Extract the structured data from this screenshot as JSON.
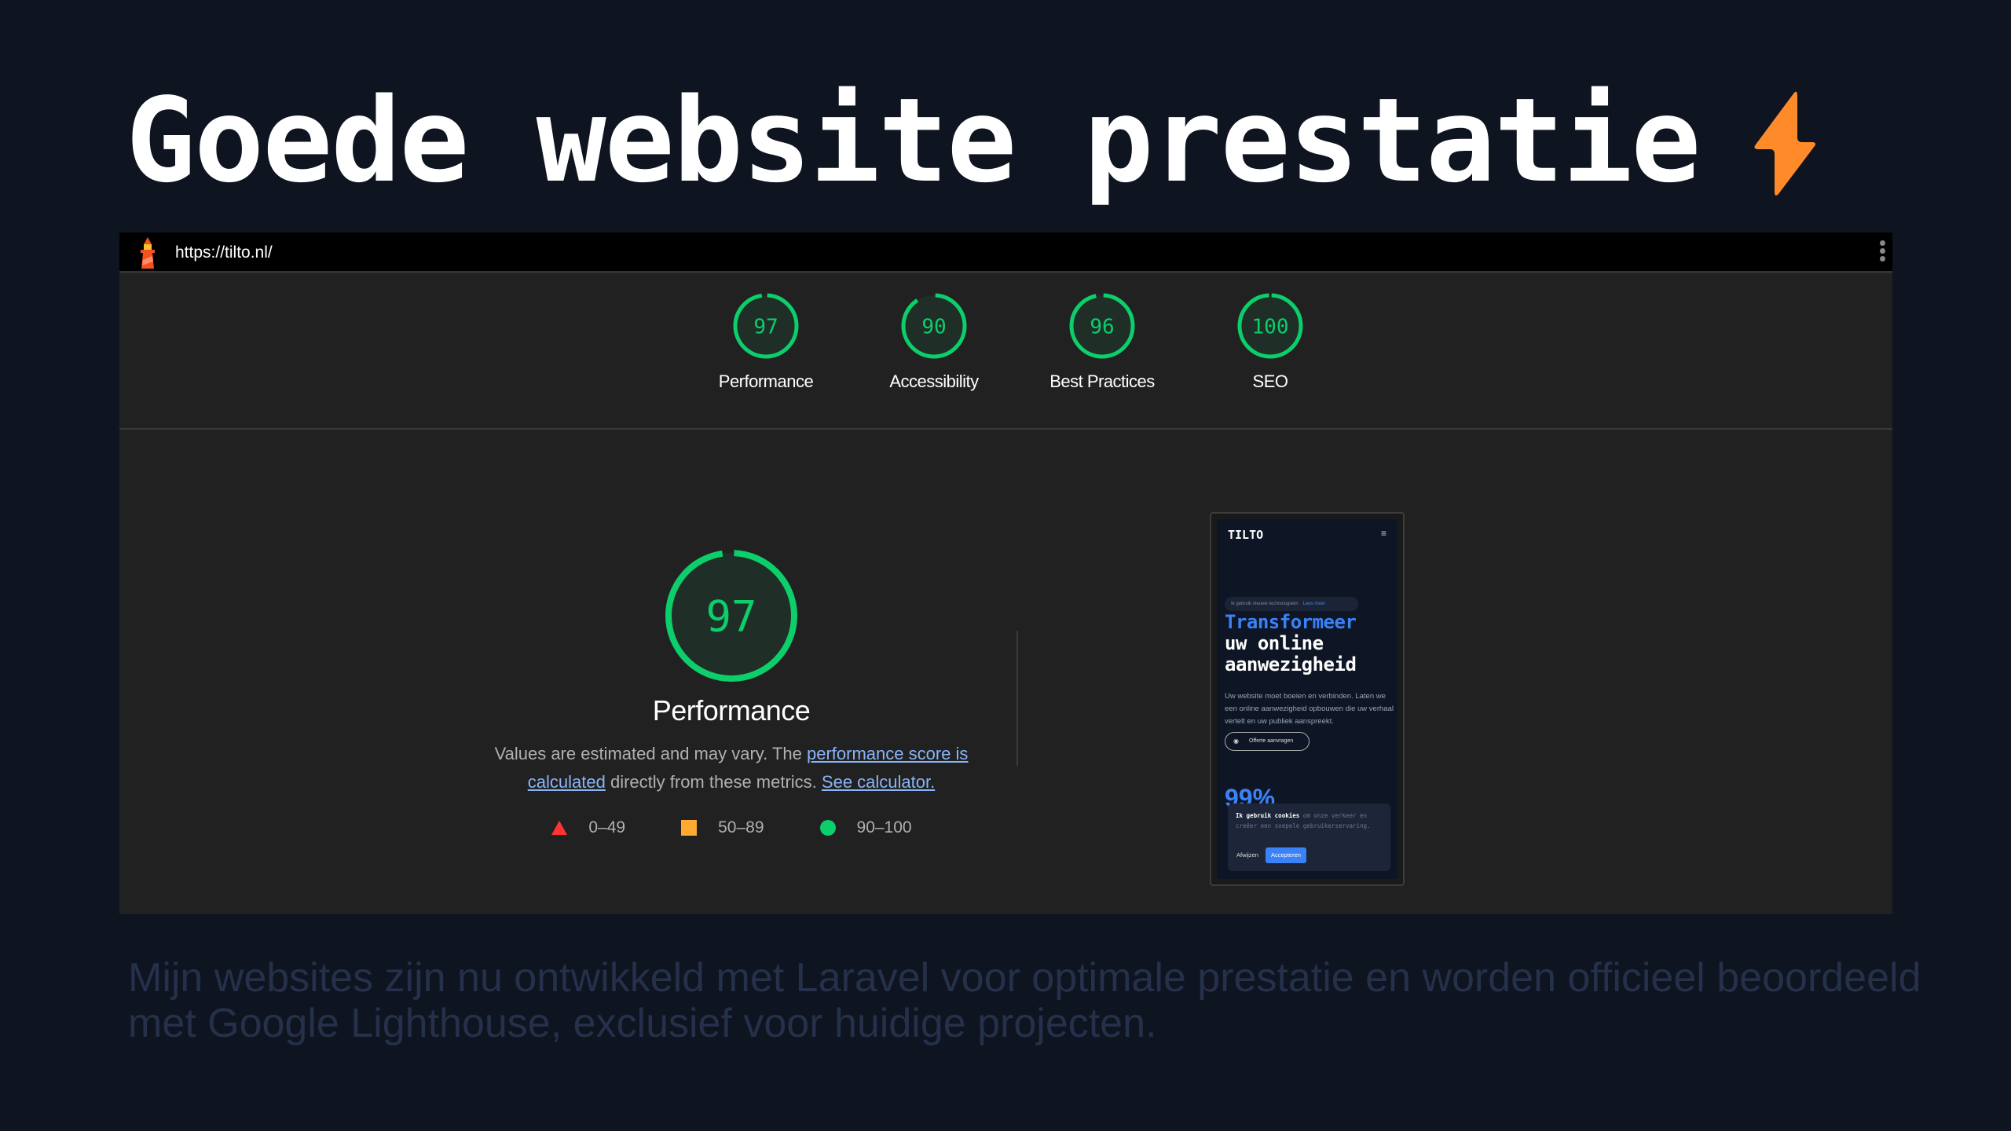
{
  "title": "Goede website prestatie",
  "title_icon": "lightning-bolt-icon",
  "accent_color": "#ff8a2a",
  "report": {
    "url": "https://tilto.nl/",
    "score_color": "#0cce6b",
    "categories": [
      {
        "label": "Performance",
        "score": 97
      },
      {
        "label": "Accessibility",
        "score": 90
      },
      {
        "label": "Best Practices",
        "score": 96
      },
      {
        "label": "SEO",
        "score": 100
      }
    ],
    "main": {
      "score": 97,
      "label": "Performance",
      "desc_1": "Values are estimated and may vary. The ",
      "link_1": "performance score is calculated",
      "desc_2": " directly from these metrics. ",
      "link_2": "See calculator.",
      "legend": [
        {
          "shape": "triangle",
          "color": "#ff3333",
          "range": "0–49"
        },
        {
          "shape": "square",
          "color": "#ffaa33",
          "range": "50–89"
        },
        {
          "shape": "circle",
          "color": "#0cce6b",
          "range": "90–100"
        }
      ]
    },
    "screenshot": {
      "logo": "TILTO",
      "menu": "≡",
      "pill": "Ik gebruik nieuwe technologieën",
      "pill_link": "Lees meer",
      "heading_1": "Transformeer",
      "heading_2": "uw online",
      "heading_3": "aanwezigheid",
      "description": "Uw website moet boeien en verbinden. Laten we een online aanwezigheid opbouwen die uw verhaal vertelt en uw publiek aanspreekt.",
      "cta": "Offerte aanvragen",
      "stat": "99%",
      "cookie_bold": "Ik gebruik cookies",
      "cookie_text": " om onze verkeer en creëer een soepele gebruikerservaring.",
      "decline": "Afwijzen",
      "accept": "Accepteren"
    }
  },
  "footer": "Mijn websites zijn nu ontwikkeld met Laravel voor optimale prestatie en worden officieel beoordeeld met Google Lighthouse, exclusief voor huidige projecten."
}
